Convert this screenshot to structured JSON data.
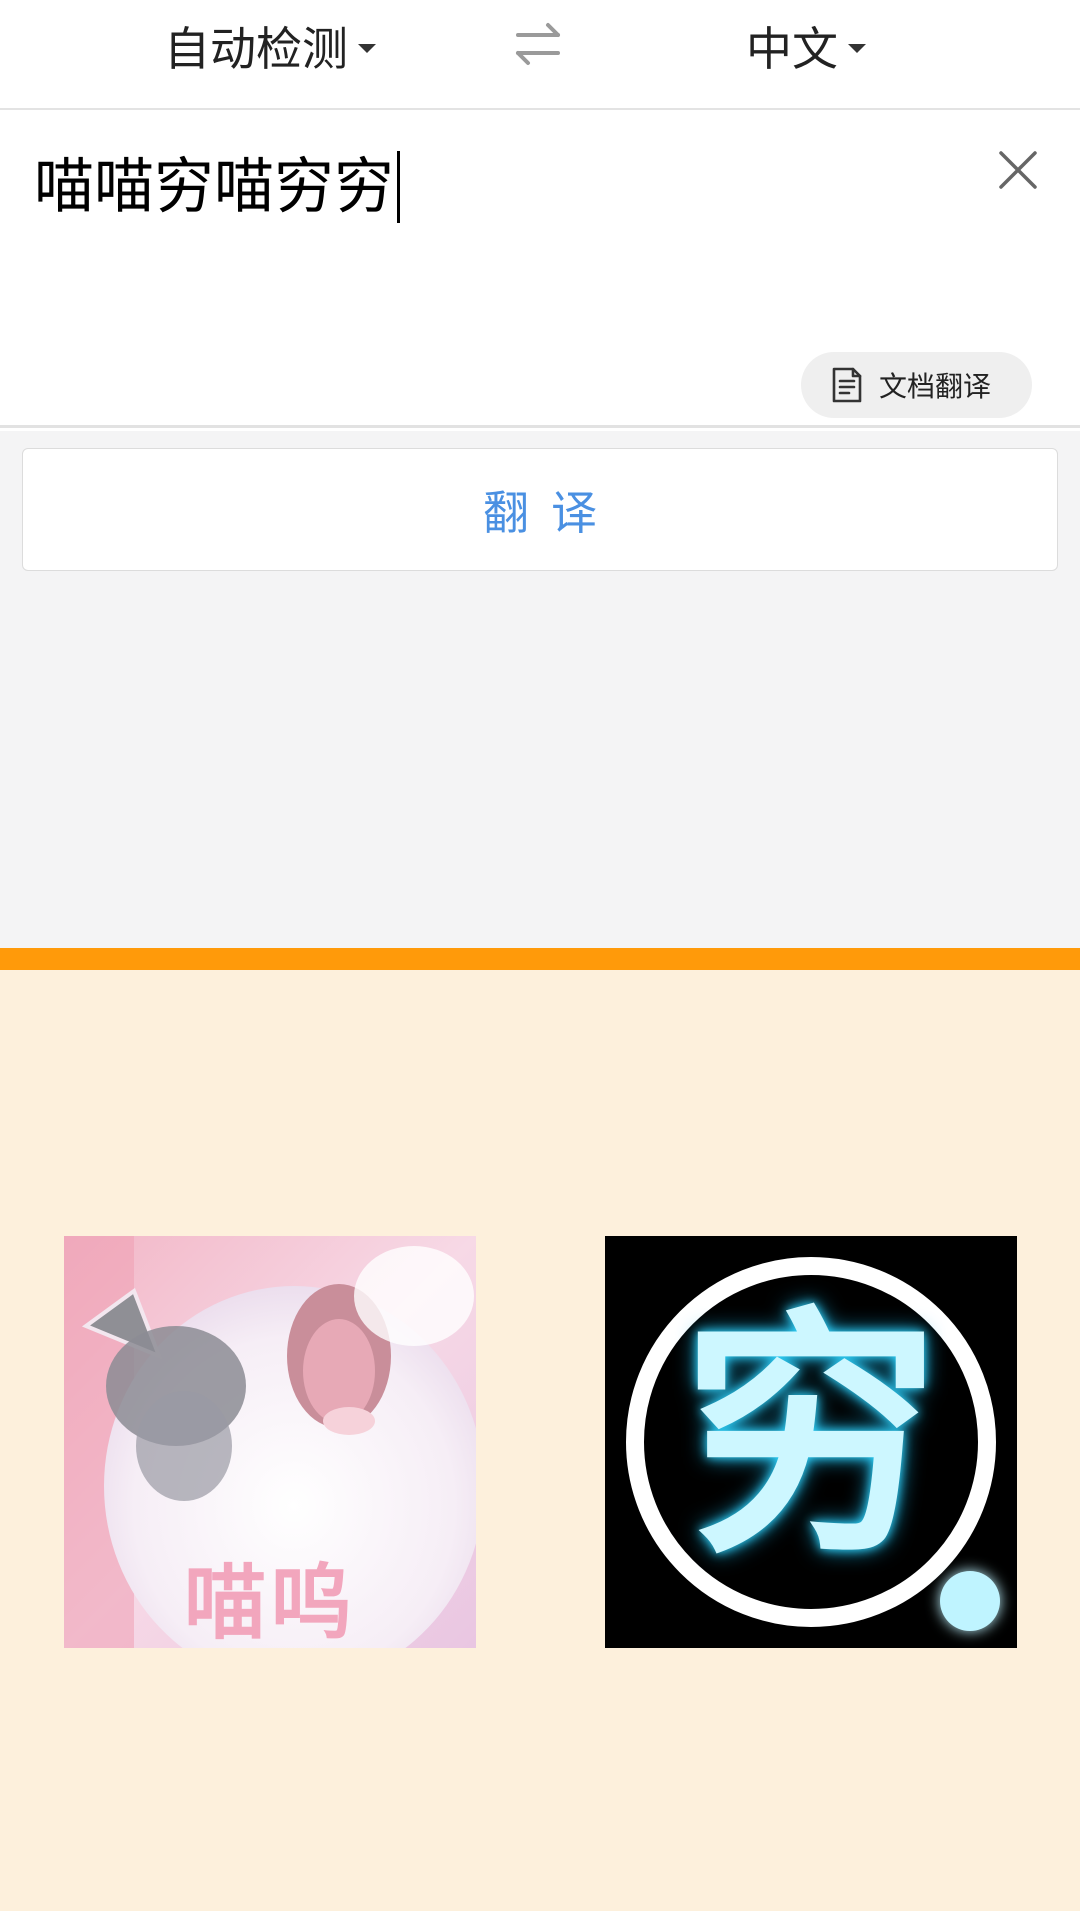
{
  "lang_bar": {
    "source_lang": "自动检测",
    "target_lang": "中文",
    "swap_icon": "swap-arrows-icon"
  },
  "input": {
    "text": "喵喵穷喵穷穷",
    "clear_icon": "close-icon"
  },
  "doc_translate": {
    "label": "文档翻译",
    "icon": "document-icon"
  },
  "translate_button": {
    "label": "翻译"
  },
  "stickers": [
    {
      "caption": "喵呜",
      "icon": "cat-sticker-image"
    },
    {
      "glyph": "穷",
      "icon": "qiong-neon-sticker-image"
    }
  ],
  "colors": {
    "accent_blue": "#4a90e2",
    "orange_strip": "#ff9a0a",
    "panel_cream": "#fdf0dc",
    "result_gray": "#f4f4f5",
    "neon_cyan": "#cdf7ff"
  }
}
